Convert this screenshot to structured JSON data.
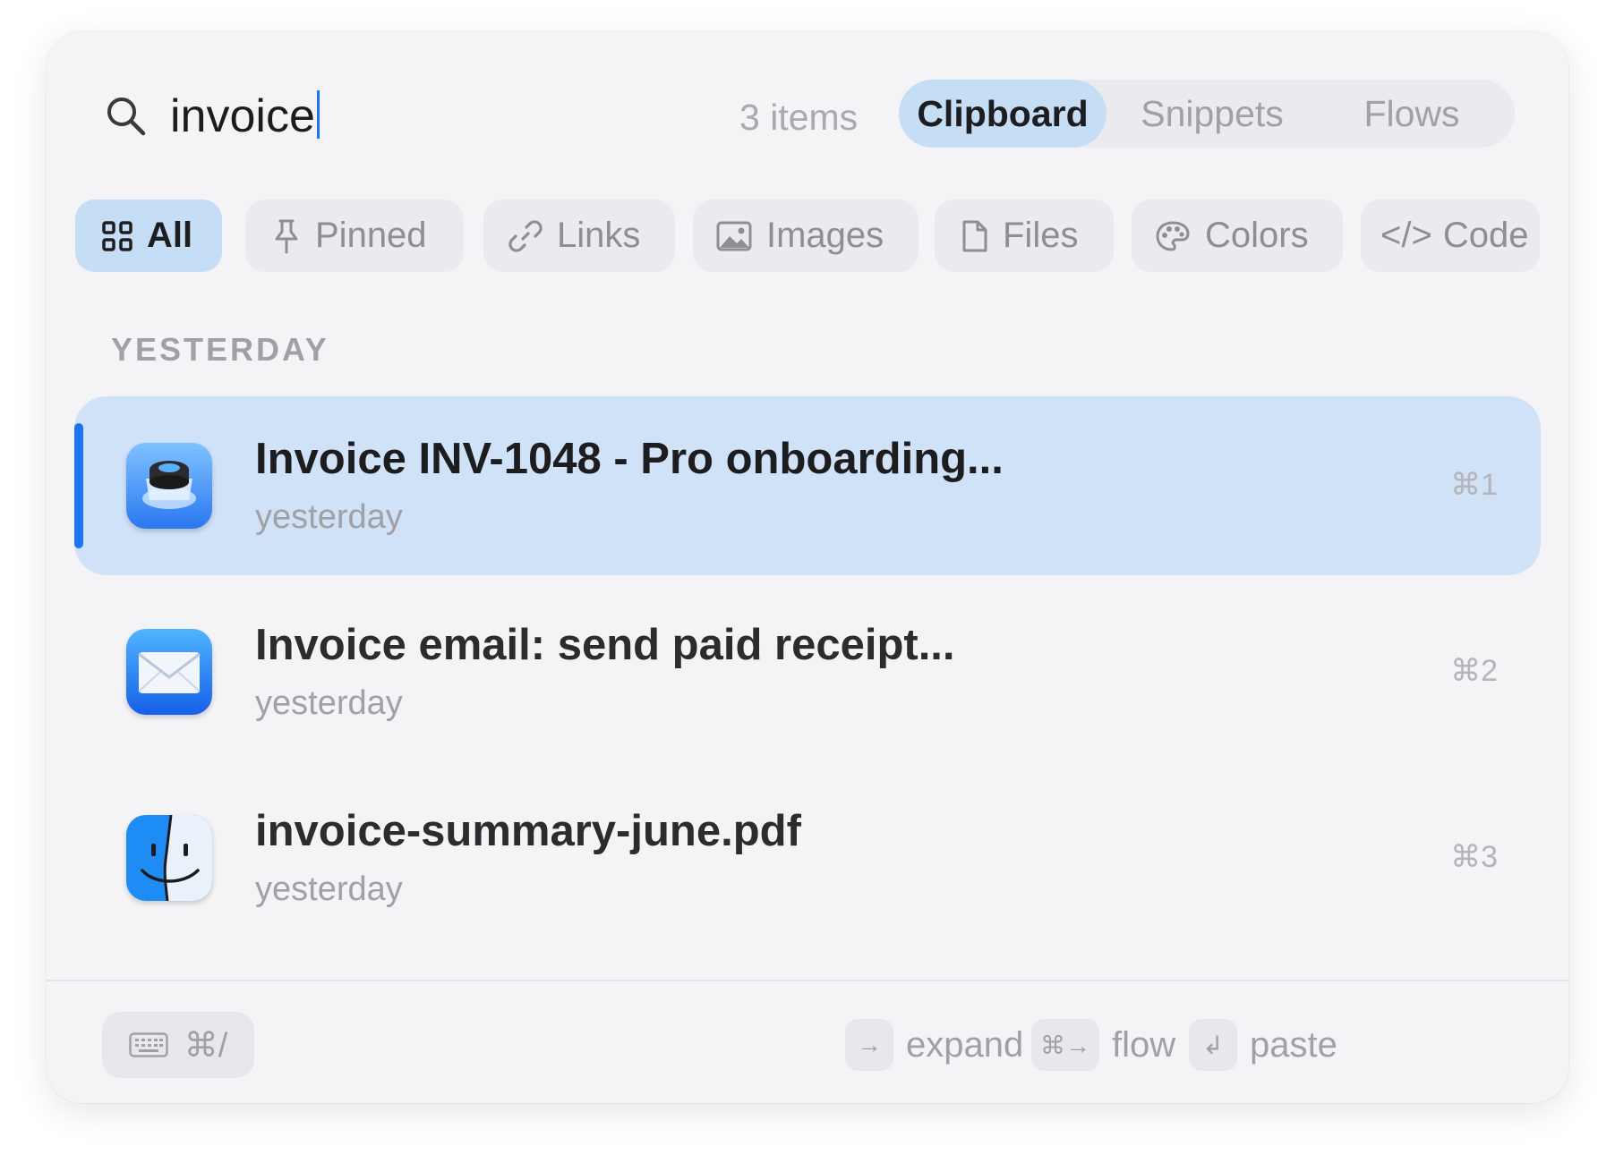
{
  "search": {
    "query": "invoice",
    "count": "3 items"
  },
  "segments": [
    {
      "label": "Clipboard",
      "active": true
    },
    {
      "label": "Snippets",
      "active": false
    },
    {
      "label": "Flows",
      "active": false
    }
  ],
  "filters": [
    {
      "label": "All",
      "icon": "grid-icon",
      "active": true
    },
    {
      "label": "Pinned",
      "icon": "pin-icon",
      "active": false
    },
    {
      "label": "Links",
      "icon": "link-icon",
      "active": false
    },
    {
      "label": "Images",
      "icon": "image-icon",
      "active": false
    },
    {
      "label": "Files",
      "icon": "file-icon",
      "active": false
    },
    {
      "label": "Colors",
      "icon": "palette-icon",
      "active": false
    },
    {
      "label": "Code",
      "icon": "code-icon",
      "active": false
    }
  ],
  "section": "YESTERDAY",
  "items": [
    {
      "title": "Invoice INV-1048 - Pro onboarding...",
      "subtitle": "yesterday",
      "shortcut": "⌘1",
      "app_icon": "preview-app-icon",
      "selected": true
    },
    {
      "title": "Invoice email: send paid receipt...",
      "subtitle": "yesterday",
      "shortcut": "⌘2",
      "app_icon": "mail-app-icon",
      "selected": false
    },
    {
      "title": "invoice-summary-june.pdf",
      "subtitle": "yesterday",
      "shortcut": "⌘3",
      "app_icon": "finder-app-icon",
      "selected": false
    }
  ],
  "footer": {
    "keyboard_shortcut": "⌘/",
    "hints": [
      {
        "key": "→",
        "label": "expand"
      },
      {
        "key": "⌘→",
        "label": "flow"
      },
      {
        "key": "↲",
        "label": "paste"
      }
    ]
  },
  "colors": {
    "accent": "#1f73f5",
    "selected_bg": "#d0e2f7",
    "chip_active_bg": "#c6ddf6",
    "panel_bg": "#f4f4f7"
  }
}
